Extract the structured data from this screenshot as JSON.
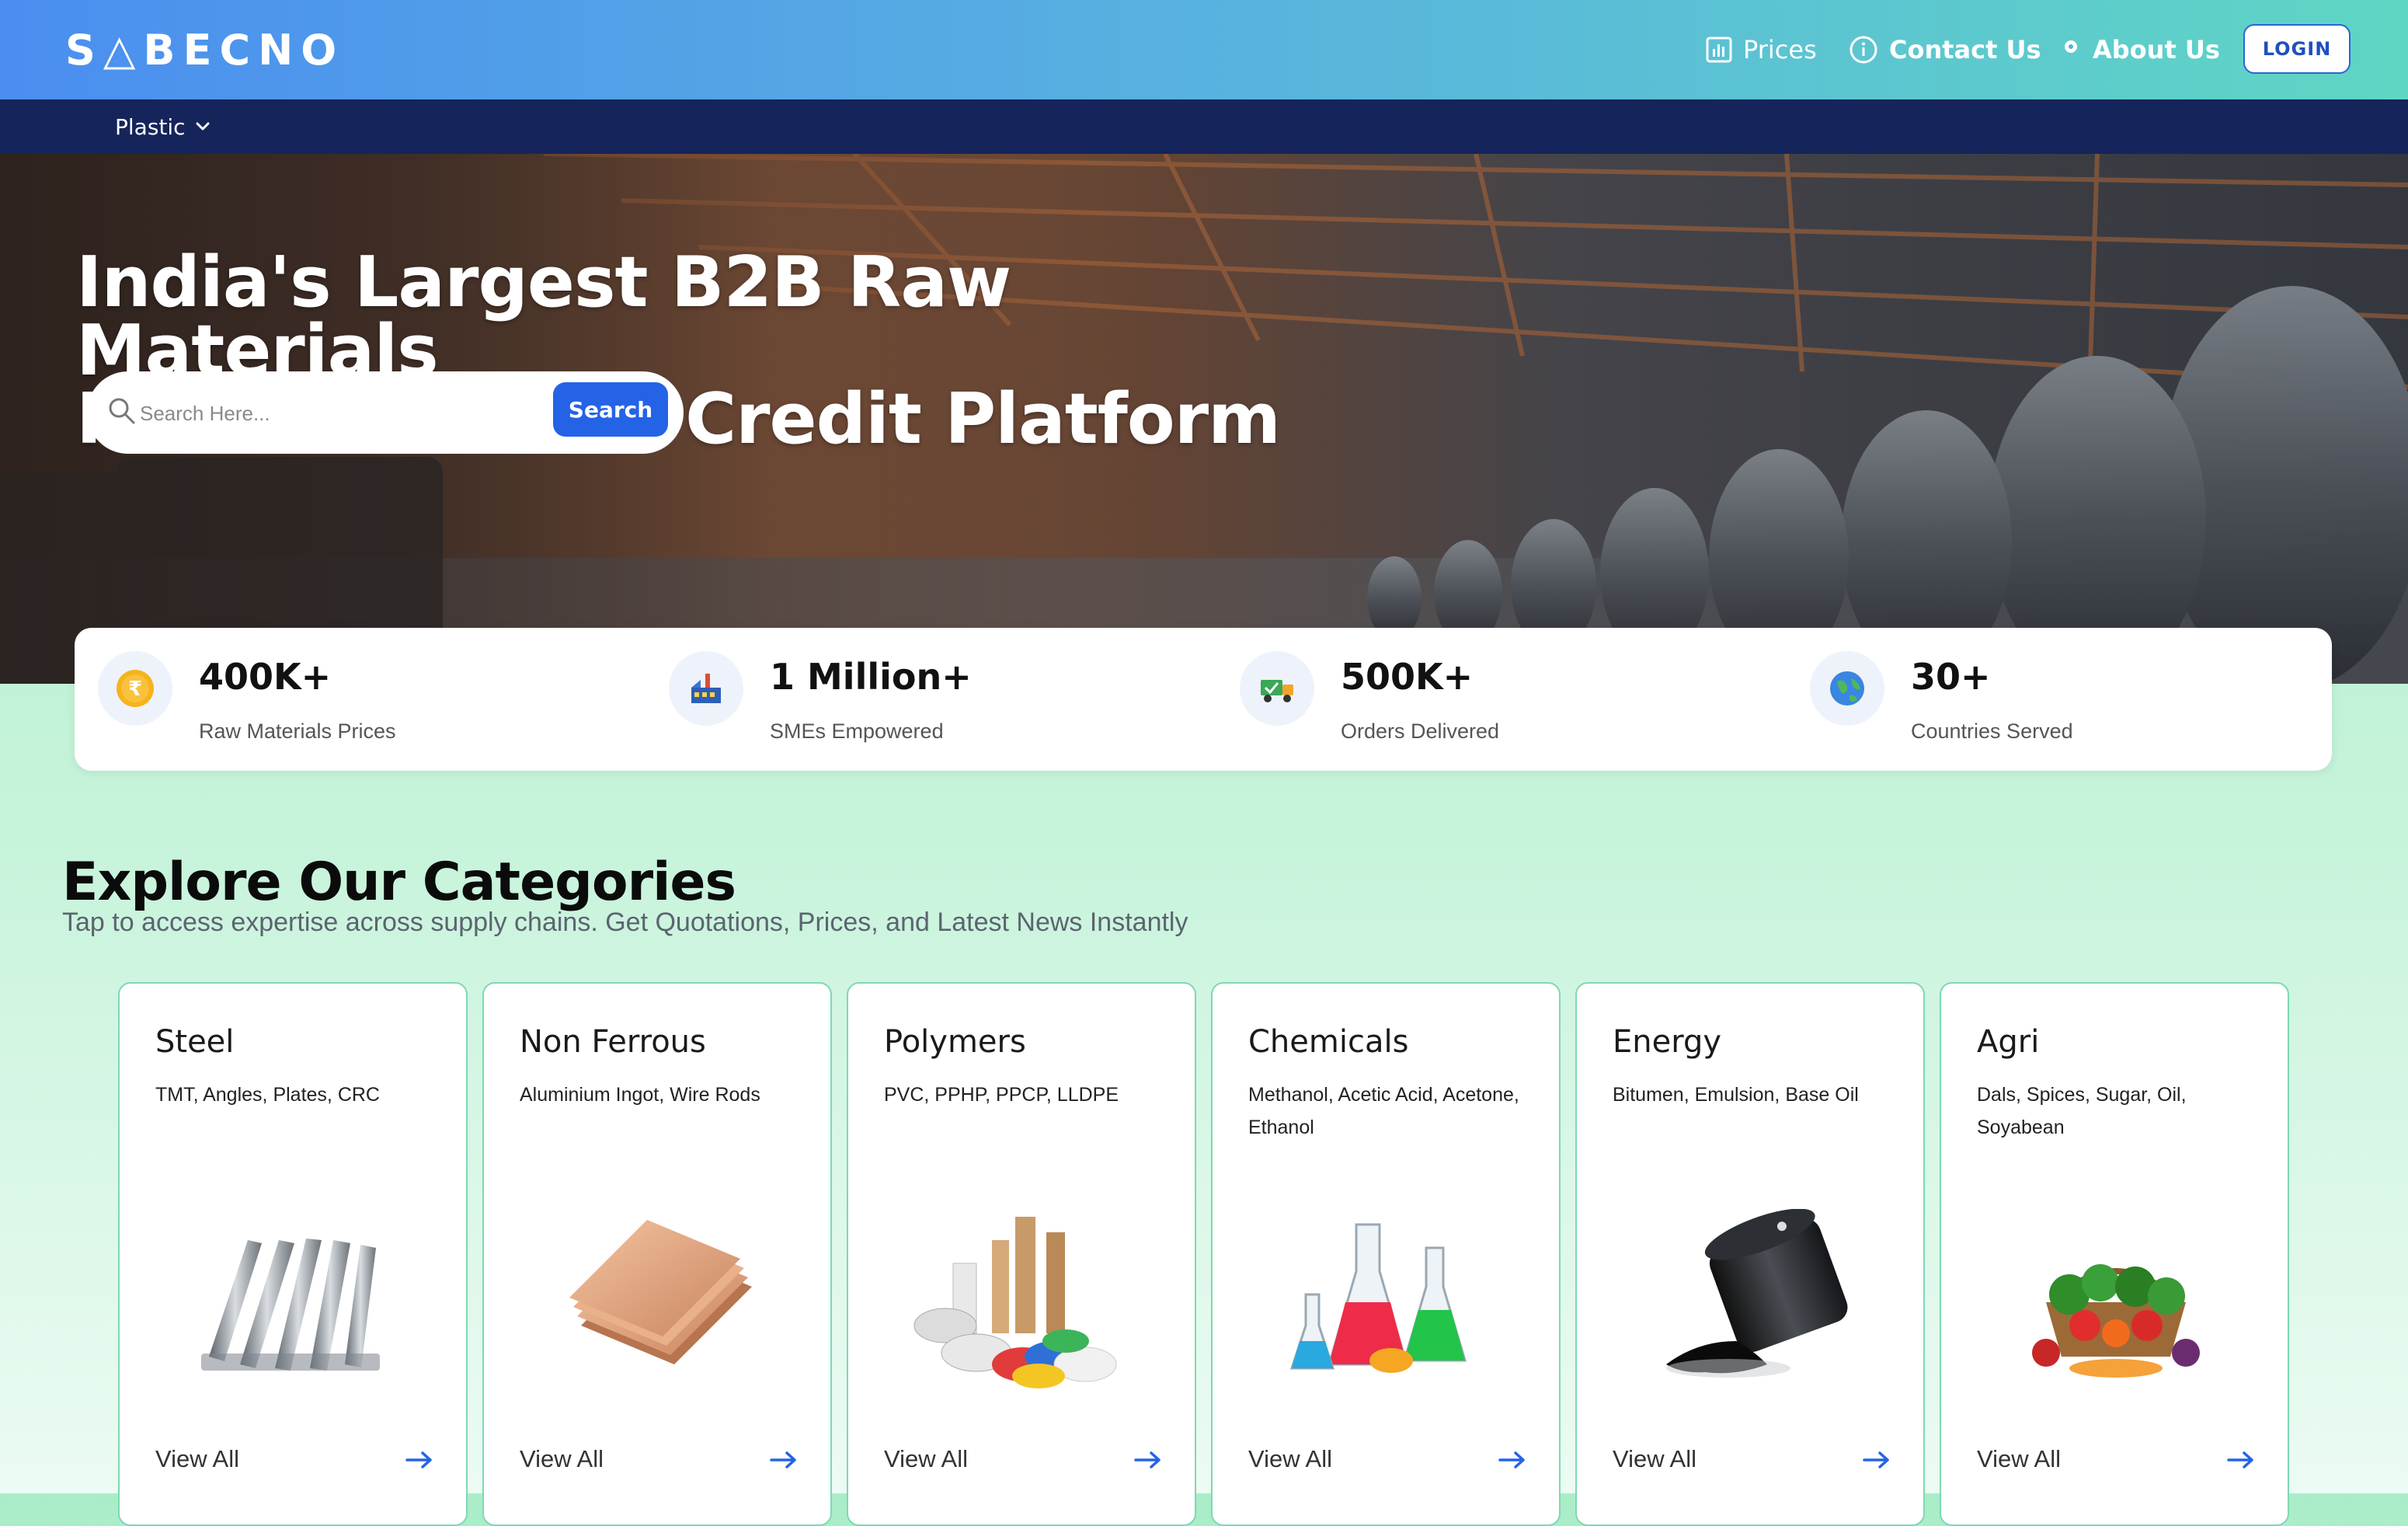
{
  "brand": {
    "logo_text": "S△BECNO"
  },
  "nav": {
    "prices": "Prices",
    "contact": "Contact Us",
    "about": "About Us",
    "login": "LOGIN"
  },
  "subnav": {
    "category": "Plastic"
  },
  "hero": {
    "title_line1": "India's Largest B2B Raw Materials",
    "title_line2": "Procurement & Credit Platform",
    "search_placeholder": "Search Here...",
    "search_button": "Search"
  },
  "stats": [
    {
      "value": "400K+",
      "label": "Raw Materials Prices",
      "icon": "rupee-coin-icon"
    },
    {
      "value": "1 Million+",
      "label": "SMEs Empowered",
      "icon": "factory-icon"
    },
    {
      "value": "500K+",
      "label": "Orders Delivered",
      "icon": "delivery-truck-icon"
    },
    {
      "value": "30+",
      "label": "Countries Served",
      "icon": "globe-icon"
    }
  ],
  "categories": {
    "heading": "Explore Our Categories",
    "subheading": "Tap to access expertise across supply chains. Get Quotations, Prices, and Latest News Instantly",
    "view_all": "View All",
    "items": [
      {
        "title": "Steel",
        "desc": "TMT, Angles, Plates, CRC",
        "image": "steel-bars-image"
      },
      {
        "title": "Non Ferrous",
        "desc": "Aluminium Ingot, Wire Rods",
        "image": "copper-sheets-image"
      },
      {
        "title": "Polymers",
        "desc": "PVC, PPHP, PPCP, LLDPE",
        "image": "polymer-rolls-granules-image"
      },
      {
        "title": "Chemicals",
        "desc": "Methanol, Acetic Acid, Acetone, Ethanol",
        "image": "lab-flasks-image"
      },
      {
        "title": "Energy",
        "desc": "Bitumen, Emulsion, Base Oil",
        "image": "oil-barrel-image"
      },
      {
        "title": "Agri",
        "desc": "Dals, Spices, Sugar, Oil, Soyabean",
        "image": "vegetable-basket-image"
      }
    ]
  },
  "colors": {
    "primary_blue": "#2463e6",
    "subnav_navy": "#15245a",
    "card_border": "#7fd8b4"
  }
}
